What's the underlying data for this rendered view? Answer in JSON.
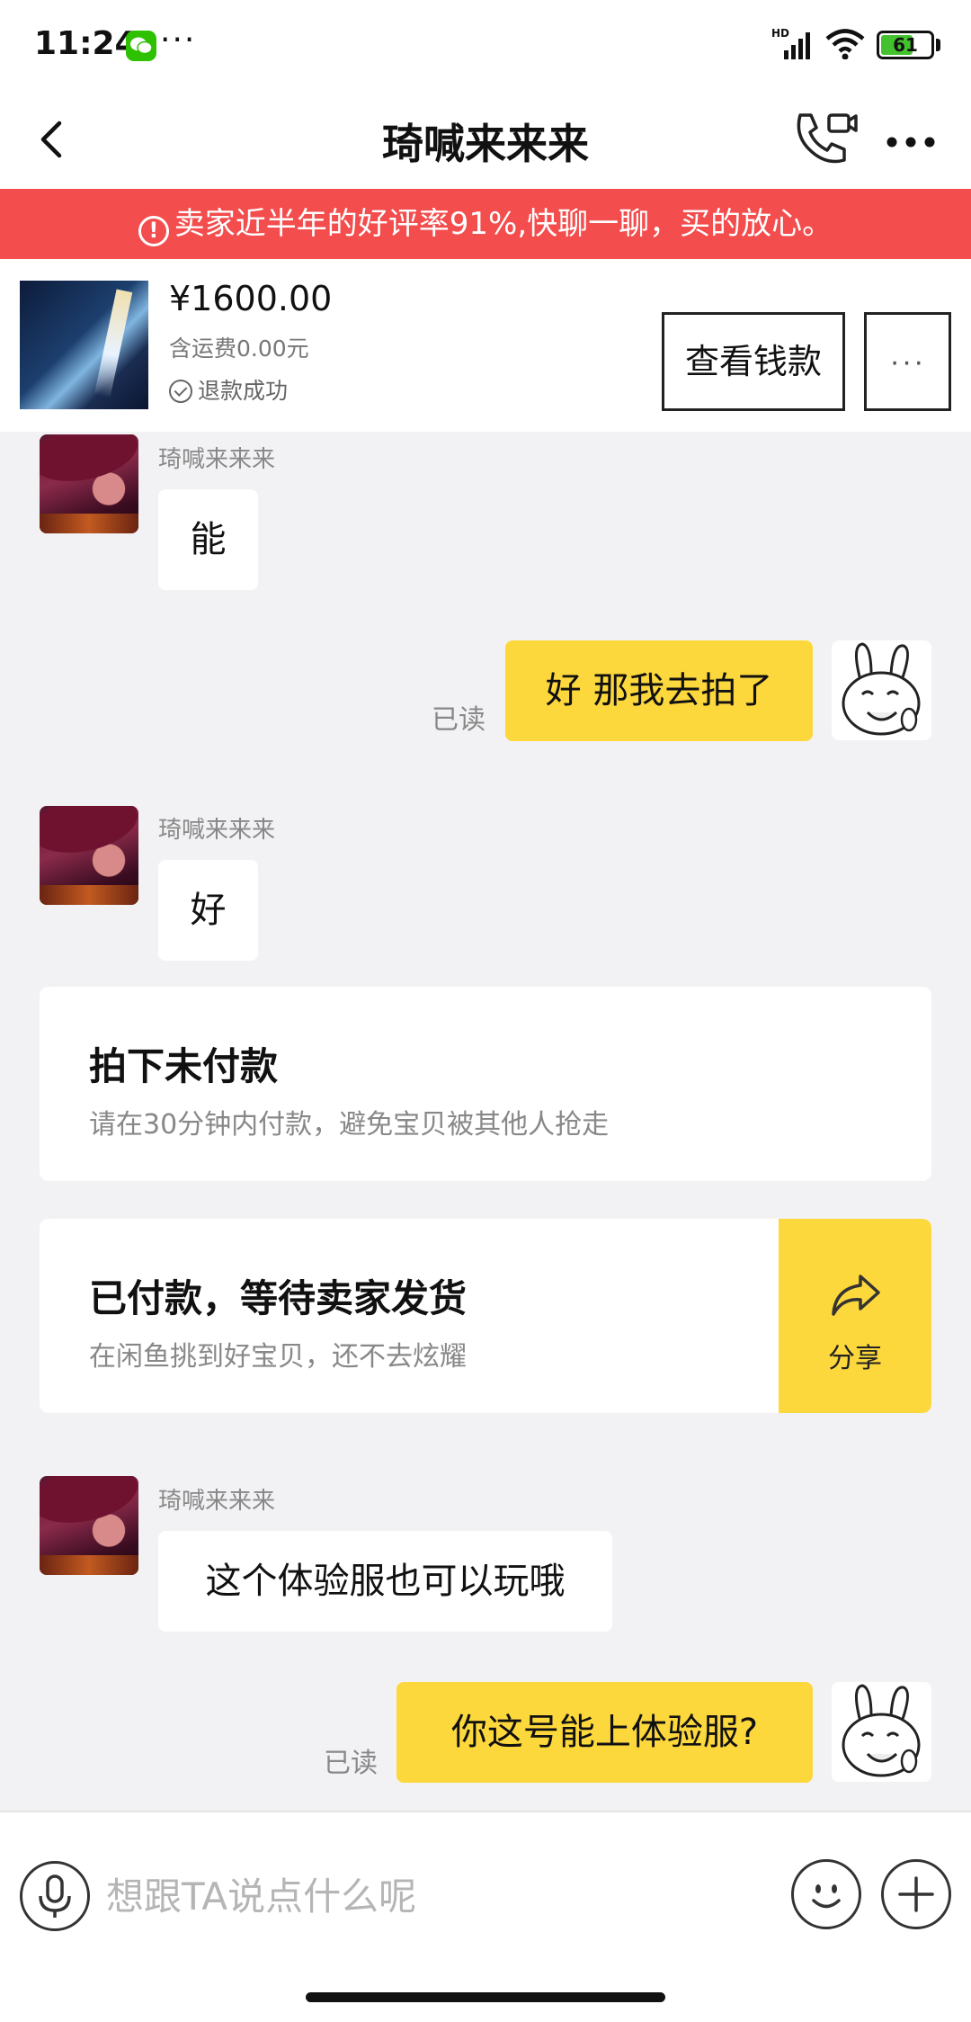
{
  "status_bar": {
    "time": "11:24",
    "more": "···",
    "network": "HD",
    "battery": "61"
  },
  "nav": {
    "title": "琦喊来来来"
  },
  "banner": {
    "icon": "!",
    "text": "卖家近半年的好评率91%,快聊一聊，买的放心。",
    "color": "#f34d4d"
  },
  "product": {
    "price": "¥1600.00",
    "shipping": "含运费0.00元",
    "status": "退款成功",
    "view_button": "查看钱款",
    "more_button": "···"
  },
  "chat": {
    "seller_name": "琦喊来来来",
    "read_label": "已读",
    "messages": [
      {
        "from": "seller",
        "text": "能"
      },
      {
        "from": "me",
        "text": "好 那我去拍了"
      },
      {
        "from": "seller",
        "text": "好"
      },
      {
        "from": "seller",
        "text": "这个体验服也可以玩哦"
      },
      {
        "from": "me",
        "text": "你这号能上体验服?"
      }
    ],
    "system_cards": [
      {
        "title": "拍下未付款",
        "subtitle": "请在30分钟内付款，避免宝贝被其他人抢走"
      },
      {
        "title": "已付款，等待卖家发货",
        "subtitle": "在闲鱼挑到好宝贝，还不去炫耀",
        "action": "分享"
      }
    ]
  },
  "input": {
    "placeholder": "想跟TA说点什么呢"
  },
  "colors": {
    "accent": "#fdd83d",
    "alert": "#f34d4d",
    "background": "#f2f2f5"
  }
}
